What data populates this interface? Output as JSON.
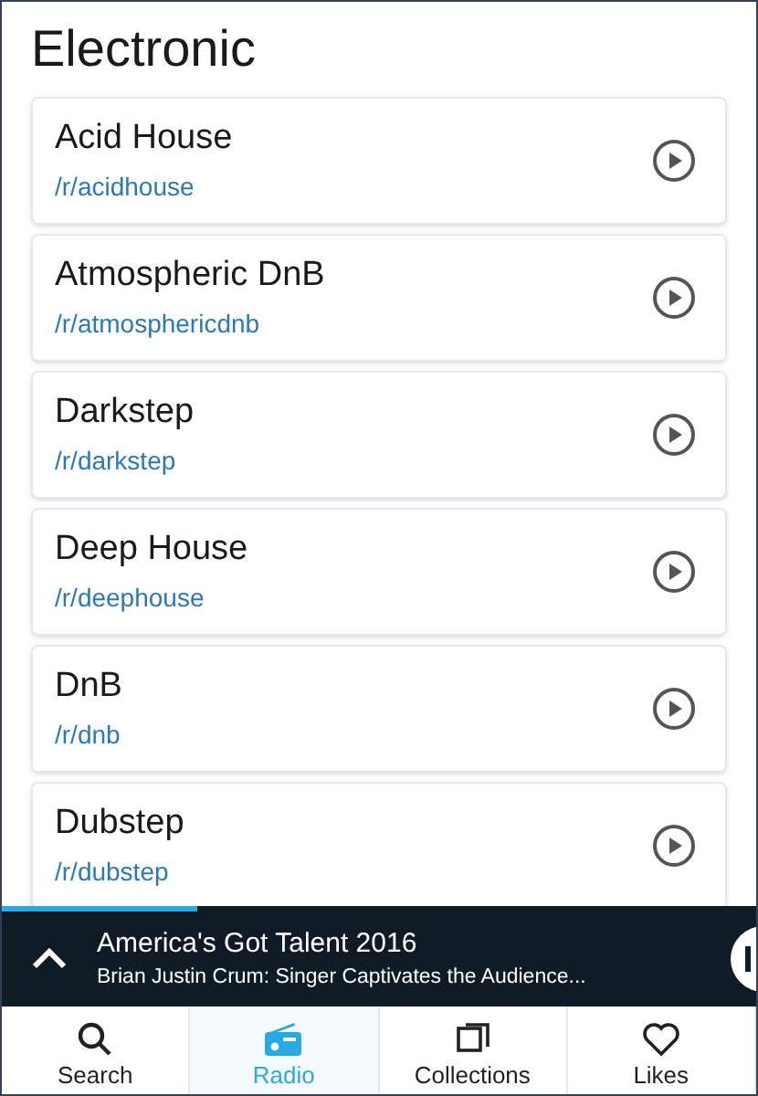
{
  "title": "Electronic",
  "stations": [
    {
      "name": "Acid House",
      "path": "/r/acidhouse"
    },
    {
      "name": "Atmospheric DnB",
      "path": "/r/atmosphericdnb"
    },
    {
      "name": "Darkstep",
      "path": "/r/darkstep"
    },
    {
      "name": "Deep House",
      "path": "/r/deephouse"
    },
    {
      "name": "DnB",
      "path": "/r/dnb"
    },
    {
      "name": "Dubstep",
      "path": "/r/dubstep"
    }
  ],
  "player": {
    "level": 0.26,
    "title": "America's Got Talent 2016",
    "subtitle": "Brian Justin Crum: Singer Captivates the Audience..."
  },
  "tabs": [
    {
      "kind": "search",
      "label": "Search",
      "selected": false
    },
    {
      "kind": "radio",
      "label": "Radio",
      "selected": true
    },
    {
      "kind": "collections",
      "label": "Collections",
      "selected": false
    },
    {
      "kind": "likes",
      "label": "Likes",
      "selected": false
    }
  ]
}
